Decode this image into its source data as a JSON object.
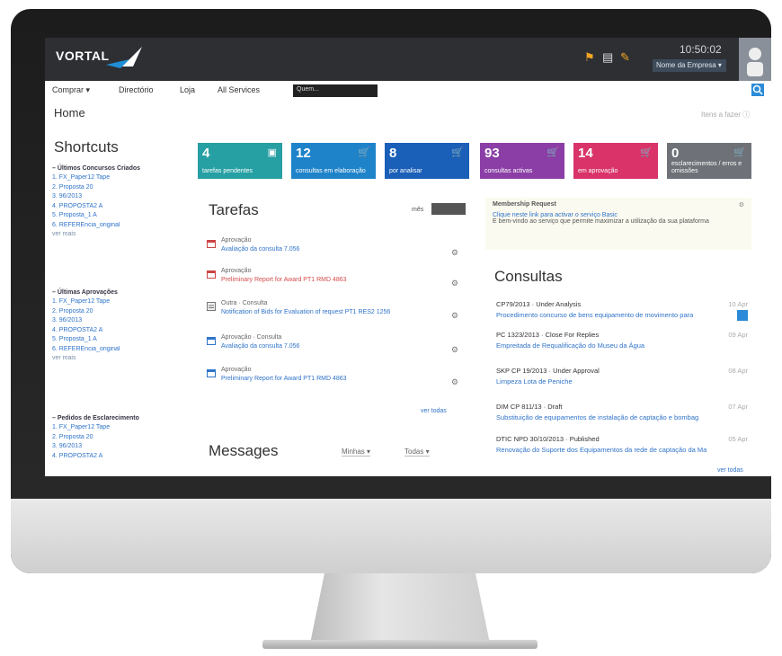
{
  "header": {
    "brand": "VORTAL",
    "clock": "10:50:02",
    "company": "Nome da Empresa ▾",
    "colors": {
      "topbar": "#2d2f33",
      "accent": "#2b8bd8"
    }
  },
  "menu": {
    "comprar": "Comprar ▾",
    "diretorio": "Directório",
    "loja": "Loja",
    "all_services": "All Services",
    "quem": "Quem..."
  },
  "page": {
    "title": "Home",
    "top_right": "Itens a fazer ⓘ"
  },
  "shortcuts": {
    "title": "Shortcuts",
    "sections": [
      {
        "title": "– Últimos Concursos Criados",
        "items": [
          "1. FX_Paper12 Tape",
          "2. Proposta 20",
          "3. 96/2013",
          "4. PROPOSTA2 A",
          "5. Proposta_1 A",
          "6. REFERÊncia_original"
        ],
        "more": "ver mais"
      },
      {
        "title": "– Últimas Aprovações",
        "items": [
          "1. FX_Paper12 Tape",
          "2. Proposta 20",
          "3. 96/2013",
          "4. PROPOSTA2 A",
          "5. Proposta_1 A",
          "6. REFERÊncia_original"
        ],
        "more": "ver mais"
      },
      {
        "title": "– Pedidos de Esclarecimento",
        "items": [
          "1. FX_Paper12 Tape",
          "2. Proposta 20",
          "3. 96/2013",
          "4. PROPOSTA2 A"
        ],
        "more": ""
      }
    ]
  },
  "tiles": [
    {
      "num": "4",
      "label": "tarefas pendentes",
      "color": "#27a0a3",
      "icon": "clipboard-icon"
    },
    {
      "num": "12",
      "label": "consultas em elaboração",
      "color": "#1f83c9",
      "icon": "cart-icon"
    },
    {
      "num": "8",
      "label": "por analisar",
      "color": "#1a5fb8",
      "icon": "cart-icon"
    },
    {
      "num": "93",
      "label": "consultas activas",
      "color": "#8b3fa6",
      "icon": "cart-icon"
    },
    {
      "num": "14",
      "label": "em aprovação",
      "color": "#d9336a",
      "icon": "cart-icon"
    },
    {
      "num": "0",
      "label": "esclarecimentos / erros e omissões",
      "color": "#6e7278",
      "icon": "cart-icon"
    }
  ],
  "tarefas": {
    "title": "Tarefas",
    "toggle": "mês",
    "items": [
      {
        "type": "Aprovação",
        "desc": "Avaliação da consulta 7.056",
        "icon": "calendar-icon"
      },
      {
        "type": "Aprovação",
        "desc": "Preliminary Report for Award PT1 RMD 4863",
        "icon": "calendar-icon"
      },
      {
        "type": "Outra · Consulta",
        "desc": "Notification of Bids for Evaluation of request PT1 RES2 1256",
        "icon": "document-icon"
      },
      {
        "type": "Aprovação · Consulta",
        "desc": "Avaliação da consulta 7.056",
        "icon": "calendar-icon"
      },
      {
        "type": "Aprovação",
        "desc": "Preliminary Report for Award PT1 RMD 4863",
        "icon": "calendar-icon"
      }
    ],
    "ver_todas": "ver todas"
  },
  "messages": {
    "title": "Messages",
    "filter1": "Minhas ▾",
    "filter2": "Todas ▾"
  },
  "membership": {
    "title": "Membership Request",
    "line1": "Clique neste link para activar o serviço Basic",
    "line2": "E bem-vindo ao serviço que permite maximizar a utilização da sua plataforma"
  },
  "consultas": {
    "title": "Consultas",
    "items": [
      {
        "id": "CP79/2013 · Under Analysis",
        "desc": "Procedimento concurso de bens equipamento de movimento para",
        "date": "10 Apr"
      },
      {
        "id": "PC 1323/2013 · Close For Replies",
        "desc": "Empreitada de Requalificação do Museu da Água",
        "date": "09 Apr"
      },
      {
        "id": "SKP CP 19/2013 · Under Approval",
        "desc": "Limpeza Lota de Peniche",
        "date": "08 Apr"
      },
      {
        "id": "DIM CP 811/13 · Draft",
        "desc": "Substituição de equipamentos de instalação de captação e bombag",
        "date": "07 Apr"
      },
      {
        "id": "DTIC NPD 30/10/2013 · Published",
        "desc": "Renovação do Suporte dos Equipamentos da rede de captação da Ma",
        "date": "05 Apr"
      }
    ],
    "ver_todas": "ver todas"
  }
}
